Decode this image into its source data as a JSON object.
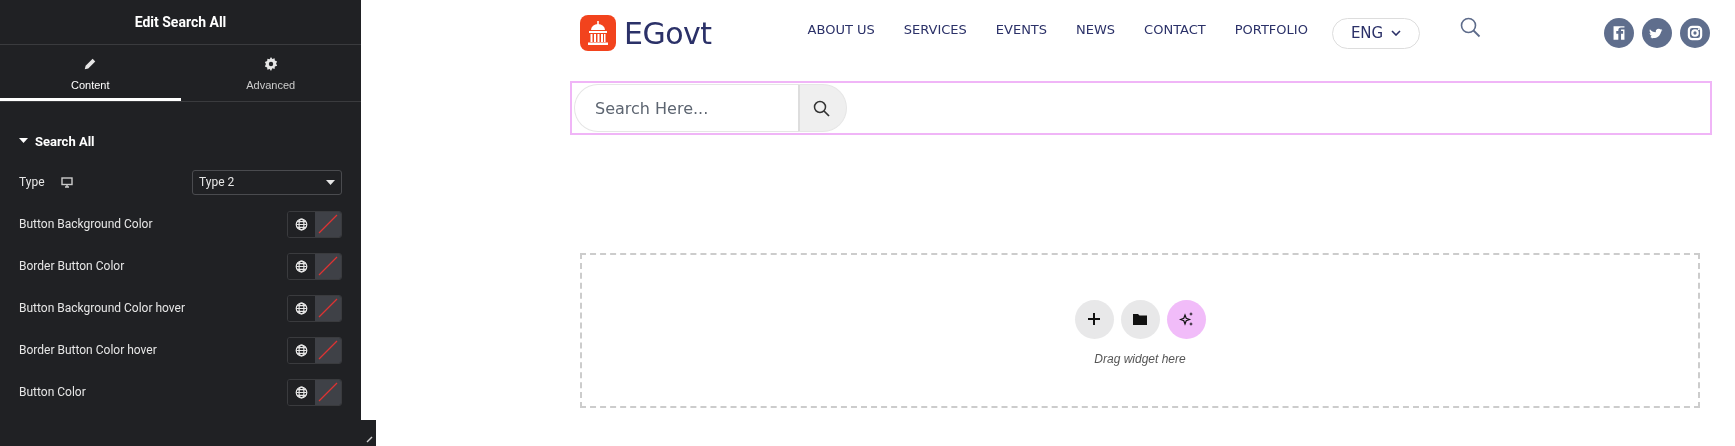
{
  "editor": {
    "title": "Edit Search All",
    "tabs": [
      {
        "label": "Content",
        "selected": true
      },
      {
        "label": "Advanced",
        "selected": false
      }
    ],
    "section": {
      "title": "Search All",
      "expanded": true
    },
    "controls": [
      {
        "kind": "select",
        "label": "Type",
        "value": "Type 2"
      },
      {
        "kind": "color",
        "label": "Button Background Color"
      },
      {
        "kind": "color",
        "label": "Border Button Color"
      },
      {
        "kind": "color",
        "label": "Button Background Color hover"
      },
      {
        "kind": "color",
        "label": "Border Button Color hover"
      },
      {
        "kind": "color",
        "label": "Button Color"
      }
    ]
  },
  "site": {
    "logo": "EGovt",
    "nav": [
      "ABOUT US",
      "SERVICES",
      "EVENTS",
      "NEWS",
      "CONTACT",
      "PORTFOLIO"
    ],
    "language": "ENG"
  },
  "search_widget": {
    "placeholder": "Search Here..."
  },
  "dropzone": {
    "hint": "Drag widget here"
  }
}
